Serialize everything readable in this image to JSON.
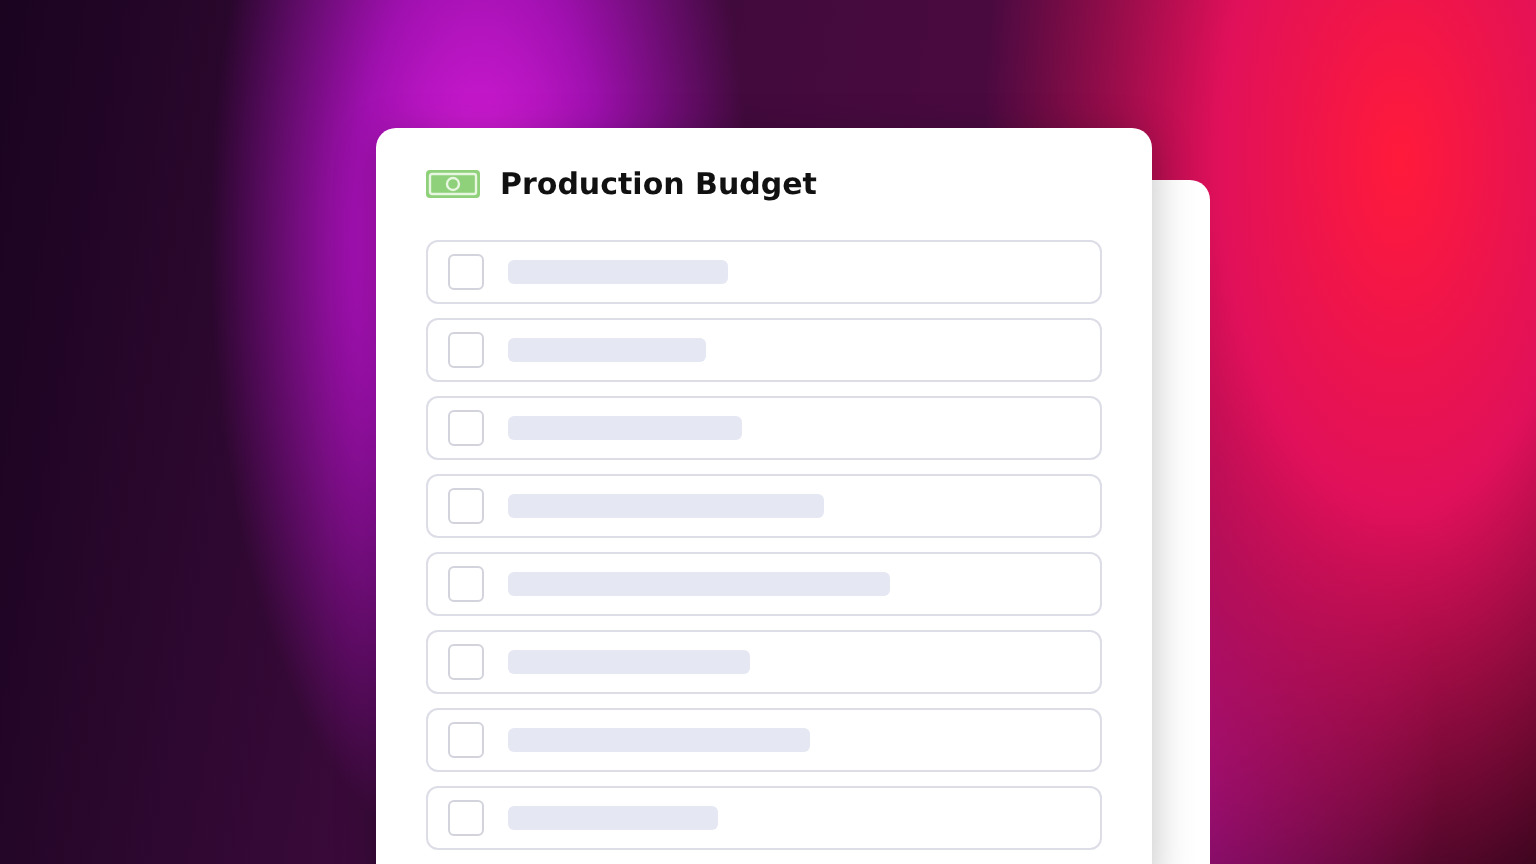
{
  "card": {
    "title": "Production Budget"
  },
  "rows": [
    {
      "checked": false
    },
    {
      "checked": false
    },
    {
      "checked": false
    },
    {
      "checked": false
    },
    {
      "checked": false
    },
    {
      "checked": false
    },
    {
      "checked": false
    },
    {
      "checked": false
    }
  ]
}
